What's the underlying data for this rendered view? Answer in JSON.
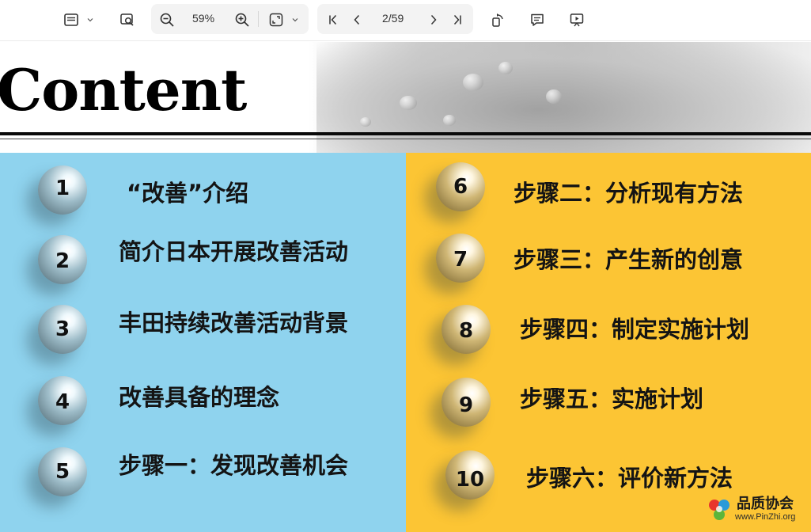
{
  "toolbar": {
    "zoom": "59%",
    "page": "2/59",
    "icons": [
      "sidebar-icon",
      "search-page-icon",
      "zoom-out-icon",
      "zoom-in-icon",
      "fit-page-icon",
      "first-page-icon",
      "prev-page-icon",
      "next-page-icon",
      "last-page-icon",
      "rotate-icon",
      "comment-icon",
      "present-icon"
    ]
  },
  "slide": {
    "title": "Content",
    "left_color": "#8fd3ee",
    "right_color": "#fcc534",
    "left_items": [
      {
        "num": "1",
        "label": "“改善”介绍"
      },
      {
        "num": "2",
        "label": "简介日本开展改善活动"
      },
      {
        "num": "3",
        "label": "丰田持续改善活动背景"
      },
      {
        "num": "4",
        "label": "改善具备的理念"
      },
      {
        "num": "5",
        "label": "步骤一：发现改善机会"
      }
    ],
    "right_items": [
      {
        "num": "6",
        "label": "步骤二：分析现有方法"
      },
      {
        "num": "7",
        "label": "步骤三：产生新的创意"
      },
      {
        "num": "8",
        "label": "步骤四：制定实施计划"
      },
      {
        "num": "9",
        "label": "步骤五：实施计划"
      },
      {
        "num": "10",
        "label": "步骤六：评价新方法"
      }
    ]
  },
  "watermark": {
    "name": "品质协会",
    "url": "www.PinZhi.org"
  }
}
